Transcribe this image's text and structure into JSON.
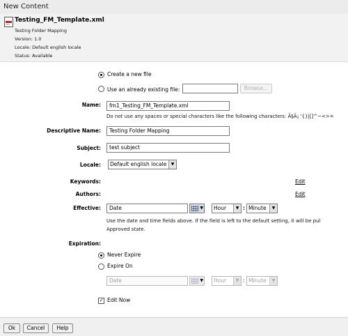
{
  "window": {
    "title": "New Content"
  },
  "file": {
    "name": "Testing_FM_Template.xml",
    "description": "Testing Folder Mapping",
    "version": "Version: 1.0",
    "locale": "Locale: Default english locale",
    "status": "Status: Available"
  },
  "source": {
    "create_new_label": "Create a new file",
    "use_existing_label": "Use an already existing file:",
    "existing_file_value": "",
    "browse_label": "Browse..."
  },
  "fields": {
    "name_label": "Name:",
    "name_value": "fm1_Testing_FM_Template.xml",
    "name_help": "Do not use any spaces or special characters like the following characters: Ã§Ã¡ '{}|[]^~<>=",
    "descriptive_name_label": "Descriptive Name:",
    "descriptive_name_value": "Testing Folder Mapping",
    "subject_label": "Subject:",
    "subject_value": "test subject",
    "locale_label": "Locale:",
    "locale_value": "Default english locale",
    "keywords_label": "Keywords:",
    "keywords_edit": "Edit",
    "authors_label": "Authors:",
    "authors_edit": "Edit"
  },
  "effective": {
    "label": "Effective:",
    "date_value": "Date",
    "hour_value": "Hour",
    "minute_value": "Minute",
    "separator": ":",
    "help_line1": "Use the date and time fields above. If the field is left to the default setting, it will be pul",
    "help_line2": "Approved state."
  },
  "expiration": {
    "label": "Expiration:",
    "never_label": "Never Expire",
    "expire_on_label": "Expire On",
    "date_value": "Date",
    "hour_value": "Hour",
    "minute_value": "Minute",
    "separator": ":"
  },
  "edit_now": {
    "label": "Edit Now",
    "checked": true,
    "mark": "✓"
  },
  "buttons": {
    "ok": "Ok",
    "cancel": "Cancel",
    "help": "Help"
  },
  "icons": {
    "dropdown": "▼"
  }
}
